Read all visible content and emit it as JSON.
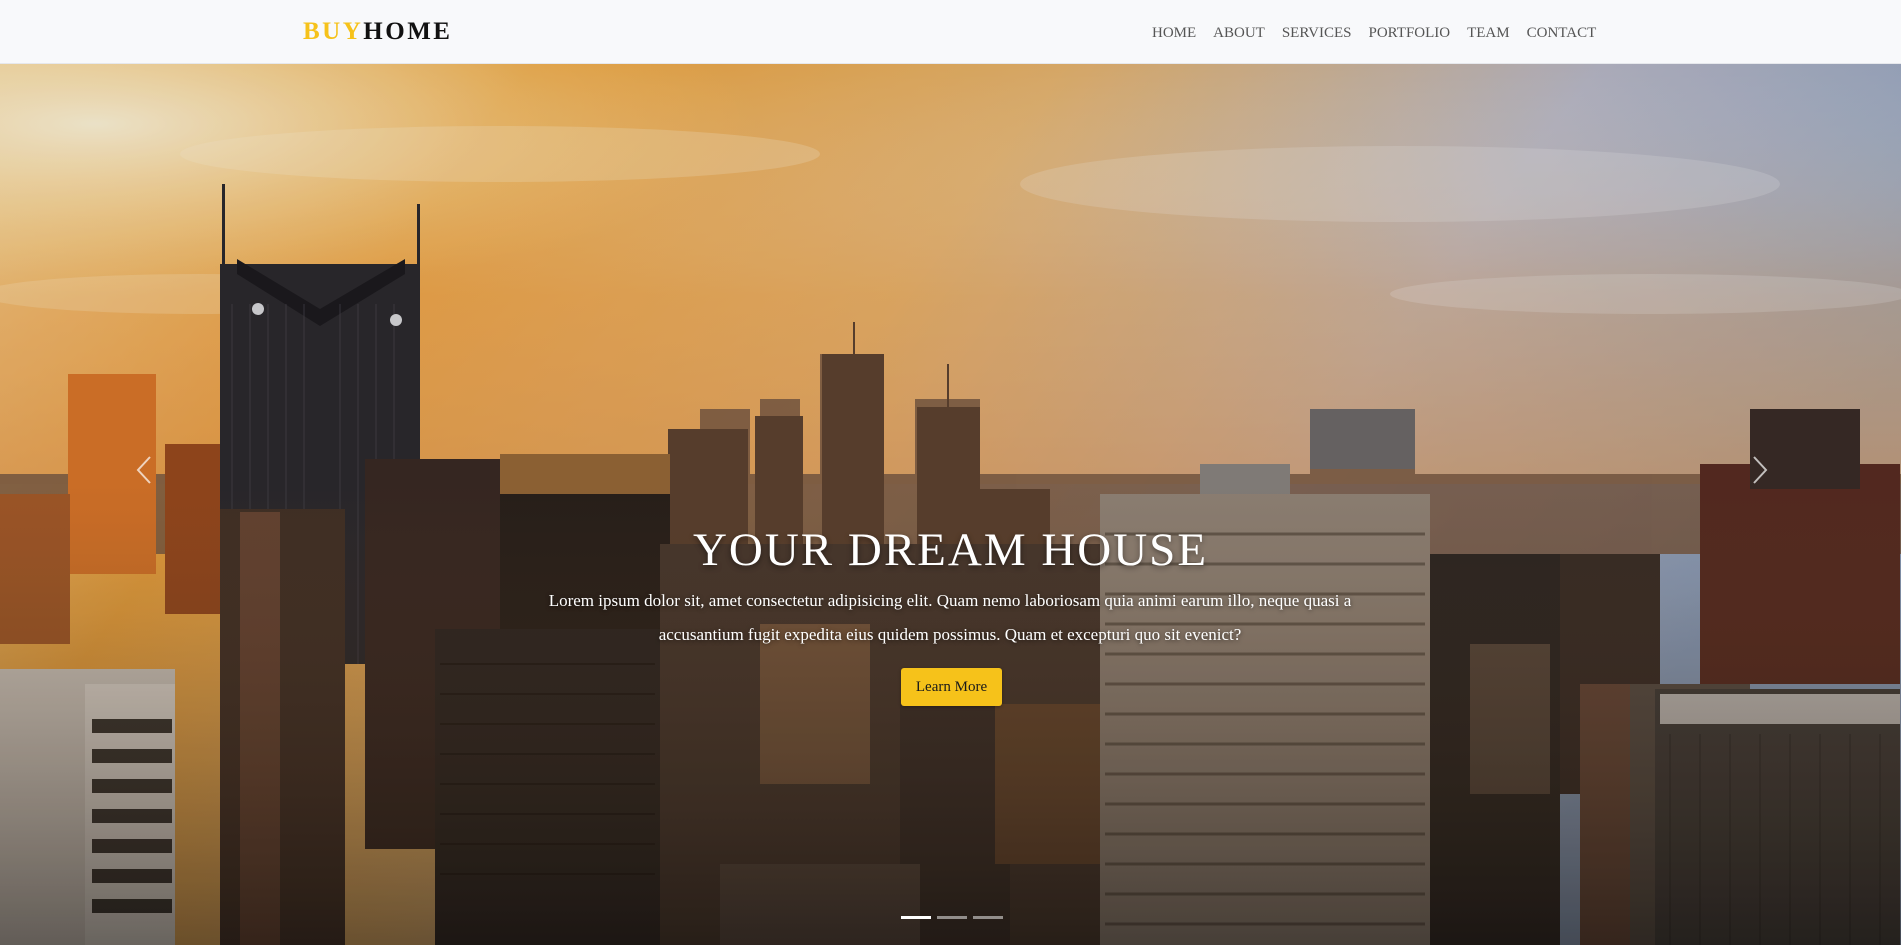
{
  "brand": {
    "part1": "BUY",
    "part2": "HOME"
  },
  "nav": {
    "items": [
      {
        "label": "HOME"
      },
      {
        "label": "ABOUT"
      },
      {
        "label": "SERVICES"
      },
      {
        "label": "PORTFOLIO"
      },
      {
        "label": "TEAM"
      },
      {
        "label": "CONTACT"
      }
    ]
  },
  "hero": {
    "title": "YOUR DREAM HOUSE",
    "text": "Lorem ipsum dolor sit, amet consectetur adipisicing elit. Quam nemo laboriosam quia animi earum illo, neque quasi a accusantium fugit expedita eius quidem possimus. Quam et excepturi quo sit evenict?",
    "button_label": "Learn More",
    "prev_icon": "chevron-left-icon",
    "next_icon": "chevron-right-icon",
    "slides": [
      {
        "active": true
      },
      {
        "active": false
      },
      {
        "active": false
      }
    ]
  },
  "colors": {
    "accent": "#f6c21a",
    "nav_bg": "#f8f9fb",
    "text_dark": "#111111"
  }
}
